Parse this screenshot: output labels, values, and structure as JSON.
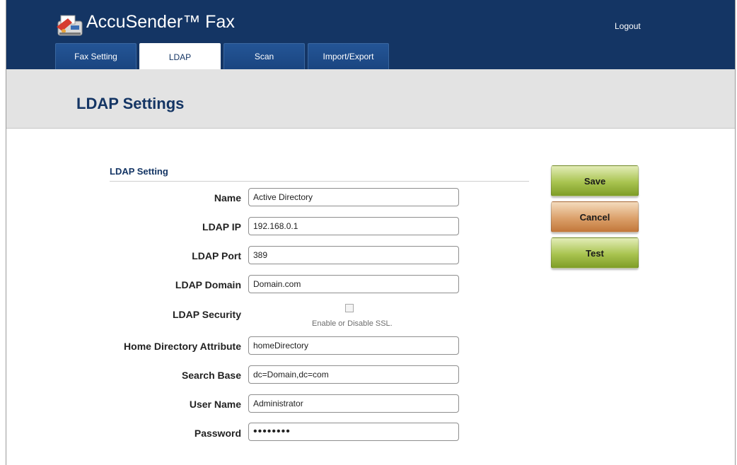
{
  "header": {
    "app_title": "AccuSender™ Fax",
    "logout_label": "Logout",
    "colors": {
      "header_bg": "#143564",
      "tab_bg": "#1c4a86",
      "title_text": "#143564"
    }
  },
  "tabs": [
    {
      "label": "Fax Setting",
      "active": false
    },
    {
      "label": "LDAP",
      "active": true
    },
    {
      "label": "Scan",
      "active": false
    },
    {
      "label": "Import/Export",
      "active": false
    }
  ],
  "page_title": "LDAP Settings",
  "section_title": "LDAP Setting",
  "form": {
    "name": {
      "label": "Name",
      "value": "Active Directory"
    },
    "ldap_ip": {
      "label": "LDAP IP",
      "value": "192.168.0.1"
    },
    "ldap_port": {
      "label": "LDAP Port",
      "value": "389"
    },
    "ldap_domain": {
      "label": "LDAP Domain",
      "value": "Domain.com"
    },
    "ldap_security": {
      "label": "LDAP Security",
      "checked": false,
      "hint": "Enable or Disable SSL."
    },
    "home_dir_attr": {
      "label": "Home Directory Attribute",
      "value": "homeDirectory"
    },
    "search_base": {
      "label": "Search Base",
      "value": "dc=Domain,dc=com"
    },
    "user_name": {
      "label": "User Name",
      "value": "Administrator"
    },
    "password": {
      "label": "Password",
      "value": "••••••••"
    }
  },
  "actions": {
    "save_label": "Save",
    "cancel_label": "Cancel",
    "test_label": "Test"
  },
  "icons": {
    "logo": "fax-machine-logo-icon",
    "checkbox": "checkbox-unchecked"
  }
}
